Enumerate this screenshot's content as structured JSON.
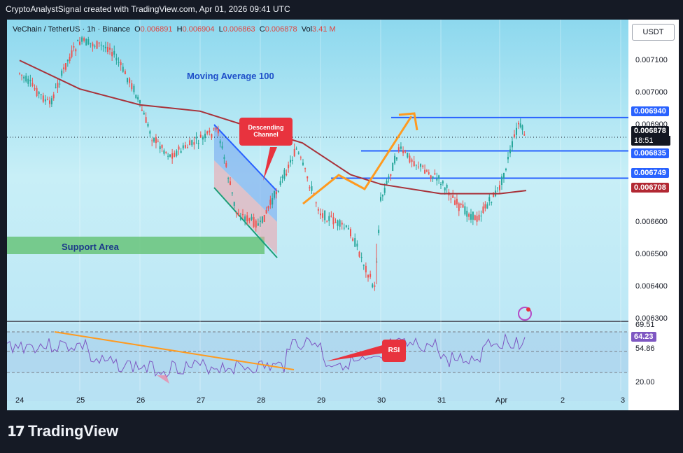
{
  "header": {
    "text": "CryptoAnalystSignal created with TradingView.com, Apr 01, 2026 09:41 UTC"
  },
  "symbol": {
    "name": "VeChain / TetherUS · 1h · Binance",
    "o_label": "O",
    "o": "0.006891",
    "h_label": "H",
    "h": "0.006904",
    "l_label": "L",
    "l": "0.006863",
    "c_label": "C",
    "c": "0.006878",
    "vol_label": "Vol",
    "vol": "3.41 M"
  },
  "currency_button": "USDT",
  "price_axis": {
    "ticks": [
      "0.007100",
      "0.007000",
      "0.006900",
      "0.006600",
      "0.006500",
      "0.006400",
      "0.006300"
    ],
    "labels": {
      "level_high": "0.006940",
      "current_price": "0.006878",
      "countdown": "18:51",
      "level_mid": "0.006835",
      "level_low": "0.006749",
      "ma_value": "0.006708"
    },
    "colors": {
      "blue": "#2962ff",
      "black": "#131722",
      "maroon": "#b22833"
    }
  },
  "rsi_axis": {
    "ticks": [
      "69.51",
      "54.86",
      "20.00"
    ],
    "current": "64.23",
    "current_color": "#7e57c2"
  },
  "time_axis": [
    "24",
    "25",
    "26",
    "27",
    "28",
    "29",
    "30",
    "31",
    "Apr",
    "2",
    "3"
  ],
  "annotations": {
    "moving_average": "Moving Average 100",
    "support_area": "Support Area",
    "descending_channel": "Descending Channel",
    "rsi": "RSI"
  },
  "footer": {
    "logo": "TradingView"
  },
  "chart_data": {
    "type": "candlestick",
    "title": "VeChain / TetherUS · 1h · Binance",
    "ylim": [
      0.0063,
      0.0072
    ],
    "x_ticks": [
      "24",
      "25",
      "26",
      "27",
      "28",
      "29",
      "30",
      "31",
      "Apr",
      "2",
      "3"
    ],
    "price_close_path": [
      {
        "x": "24",
        "y": 0.00708
      },
      {
        "x": "24.5",
        "y": 0.00698
      },
      {
        "x": "24.8",
        "y": 0.00712
      },
      {
        "x": "25",
        "y": 0.00718
      },
      {
        "x": "25.5",
        "y": 0.00716
      },
      {
        "x": "25.9",
        "y": 0.00703
      },
      {
        "x": "26.2",
        "y": 0.00688
      },
      {
        "x": "26.5",
        "y": 0.00682
      },
      {
        "x": "26.9",
        "y": 0.00686
      },
      {
        "x": "27.3",
        "y": 0.0069
      },
      {
        "x": "27.6",
        "y": 0.00664
      },
      {
        "x": "28",
        "y": 0.0066
      },
      {
        "x": "28.3",
        "y": 0.00672
      },
      {
        "x": "28.6",
        "y": 0.00684
      },
      {
        "x": "29",
        "y": 0.00664
      },
      {
        "x": "29.5",
        "y": 0.00658
      },
      {
        "x": "29.9",
        "y": 0.0064
      },
      {
        "x": "30",
        "y": 0.00668
      },
      {
        "x": "30.3",
        "y": 0.00684
      },
      {
        "x": "30.7",
        "y": 0.00678
      },
      {
        "x": "31",
        "y": 0.00674
      },
      {
        "x": "31.3",
        "y": 0.00666
      },
      {
        "x": "31.6",
        "y": 0.00662
      },
      {
        "x": "Apr",
        "y": 0.00672
      },
      {
        "x": "Apr.2",
        "y": 0.00692
      },
      {
        "x": "Apr.3",
        "y": 0.00688
      }
    ],
    "moving_average_100": [
      {
        "x": "24",
        "y": 0.00712
      },
      {
        "x": "25",
        "y": 0.00703
      },
      {
        "x": "26",
        "y": 0.00698
      },
      {
        "x": "27",
        "y": 0.00696
      },
      {
        "x": "28",
        "y": 0.0069
      },
      {
        "x": "28.7",
        "y": 0.00686
      },
      {
        "x": "29.5",
        "y": 0.00676
      },
      {
        "x": "30",
        "y": 0.00673
      },
      {
        "x": "31",
        "y": 0.0067
      },
      {
        "x": "Apr",
        "y": 0.0067
      },
      {
        "x": "Apr.3",
        "y": 0.00671
      }
    ],
    "horizontal_levels": [
      0.00694,
      0.006835,
      0.006749
    ],
    "rsi": {
      "current": 64.23,
      "levels": [
        69.51,
        54.86,
        20.0
      ]
    }
  }
}
